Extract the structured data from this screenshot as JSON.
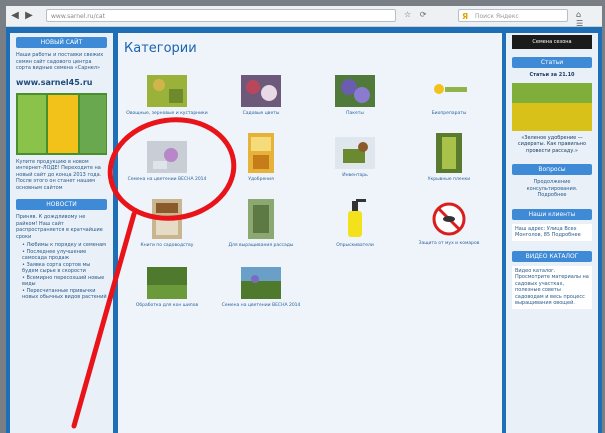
{
  "browser": {
    "address": "www.sarnel.ru/cat",
    "search_placeholder": "Поиск Яндекс"
  },
  "page": {
    "title": "Категории"
  },
  "left": {
    "block1_head": "НОВЫЙ САЙТ",
    "block1_text": "Наши работы и поставки свежих семян сайт садового центра сорта видные семена «Сарнел»",
    "site_url": "www.sarnel45.ru",
    "block1_footer": "Купите продукцию в новом интернет-ЛОДЕ! Переходите на новый сайт до конца 2013 года. После этого он станет нашим основным сайтом",
    "block2_head": "НОВОСТИ",
    "block2_text": "Приняв. К дождливому не райком! Наш сайт распространяется в кратчайшие сроки",
    "bullets": [
      "Любимы к порядку и семенам",
      "Последнее улучшение самосада продаж",
      "Заявка сорта сортов мы будем сырье в скорости",
      "Всемирно пересохший новые виды",
      "Пересчитанные привычки новых обычных видов растений"
    ]
  },
  "categories": [
    {
      "label": "Овощные, зерновые и кустарники"
    },
    {
      "label": "Садовые цветы"
    },
    {
      "label": "Пакеты"
    },
    {
      "label": "Биопрепараты"
    },
    {
      "label": "Семена на цветении ВЕСНА 2014"
    },
    {
      "label": "Удобрения"
    },
    {
      "label": "Инвентарь"
    },
    {
      "label": "Укрывные пленки"
    },
    {
      "label": "Книги по садоводству"
    },
    {
      "label": "Для выращивания рассады"
    },
    {
      "label": "Опрыскиватели"
    },
    {
      "label": "Защита от мух и комаров"
    },
    {
      "label": "Обработка для кон шипов"
    },
    {
      "label": "Семена на цветении ВЕСНА 2014"
    }
  ],
  "right": {
    "top_bar": "Семена сезона",
    "block1_head": "Статьи",
    "block1_date": "Статьи за 21.10",
    "block1_caption": "«Зеленое удобрение — сидераты. Как правильно провести рассаду.»",
    "block2_head": "Вопросы",
    "block2_text": "Продолжение консультирования. Подробнее",
    "block3_head": "Наши клиенты",
    "block3_text": "Наш адрес: Улица Всех Монголов, 85 Подробнее",
    "block4_head": "ВИДЕО КАТАЛОГ",
    "block4_text": "Видео каталог. Просмотрите материалы на садовых участках, полезные советы садоводам и весь процесс выращивания овощей."
  },
  "colors": {
    "page_bg": "#1e6fb5",
    "accent_circle": "#e8141a"
  }
}
